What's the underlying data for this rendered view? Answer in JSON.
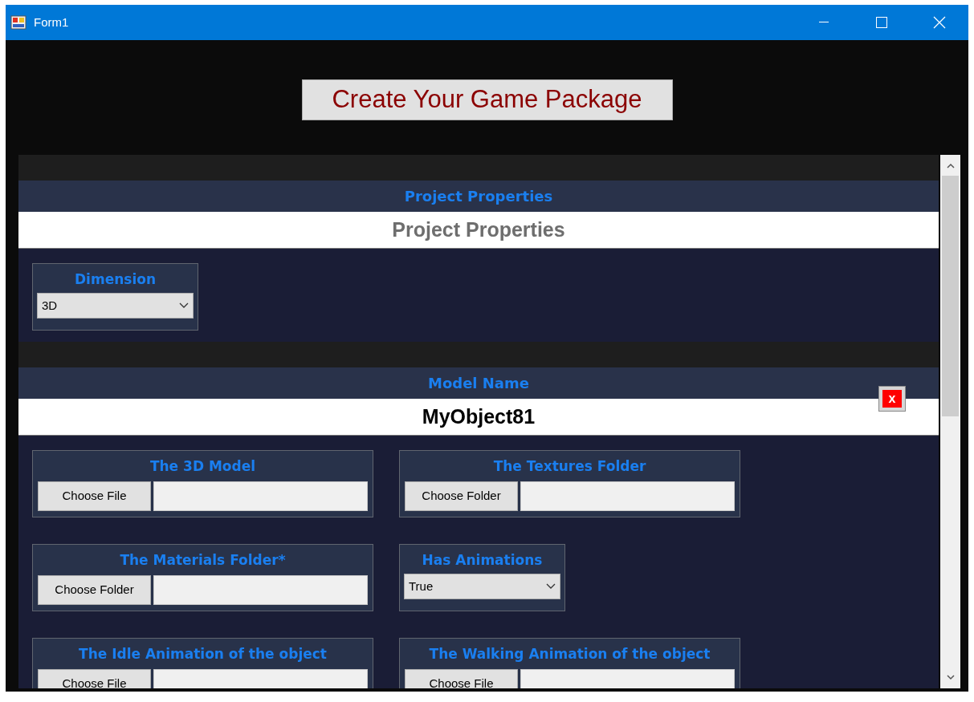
{
  "window": {
    "title": "Form1"
  },
  "create_button": "Create Your Game Package",
  "sections": [
    {
      "header": "Project Properties",
      "name": "Project Properties",
      "kind": "muted",
      "fields": [
        {
          "kind": "select",
          "label": "Dimension",
          "value": "3D"
        }
      ]
    },
    {
      "header": "Model Name",
      "name": "MyObject81",
      "kind": "strong",
      "remove_label": "x",
      "fields": [
        {
          "kind": "file",
          "label": "The 3D Model",
          "button": "Choose File"
        },
        {
          "kind": "file",
          "label": "The Textures Folder",
          "button": "Choose Folder"
        },
        {
          "kind": "file",
          "label": "The Materials Folder*",
          "button": "Choose Folder"
        },
        {
          "kind": "select",
          "label": "Has Animations",
          "value": "True"
        },
        {
          "kind": "file",
          "label": "The Idle Animation of the object",
          "button": "Choose File"
        },
        {
          "kind": "file",
          "label": "The Walking Animation of the object",
          "button": "Choose File"
        }
      ]
    }
  ]
}
